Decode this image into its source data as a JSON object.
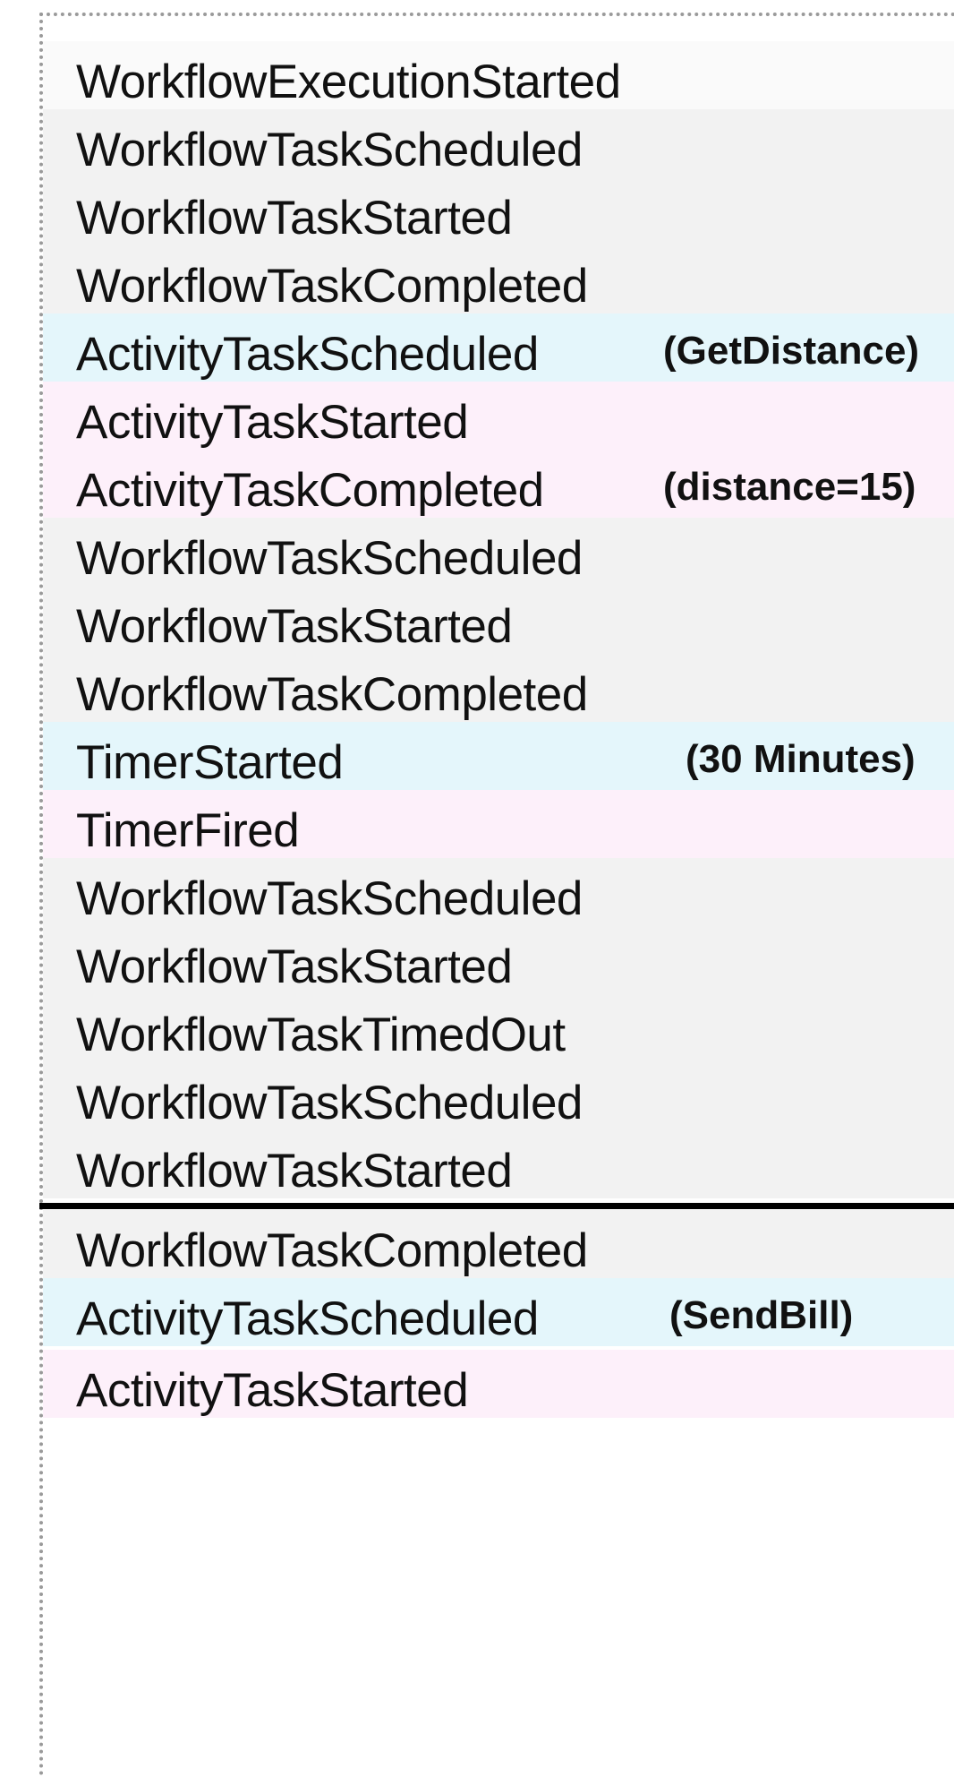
{
  "colors": {
    "workflow": "#f2f2f2",
    "activity_scheduled": "#e4f6fb",
    "activity_result": "#fdf0fa",
    "first_row": "#fafafa",
    "divider": "#000000"
  },
  "history_before": [
    {
      "event": "WorkflowExecutionStarted",
      "note": "",
      "kind": "first_row"
    },
    {
      "event": "WorkflowTaskScheduled",
      "note": "",
      "kind": "workflow"
    },
    {
      "event": "WorkflowTaskStarted",
      "note": "",
      "kind": "workflow"
    },
    {
      "event": "WorkflowTaskCompleted",
      "note": "",
      "kind": "workflow"
    },
    {
      "event": "ActivityTaskScheduled",
      "note": "(GetDistance)",
      "kind": "activity_scheduled"
    },
    {
      "event": "ActivityTaskStarted",
      "note": "",
      "kind": "activity_result"
    },
    {
      "event": "ActivityTaskCompleted",
      "note": "(distance=15)",
      "kind": "activity_result"
    },
    {
      "event": "WorkflowTaskScheduled",
      "note": "",
      "kind": "workflow"
    },
    {
      "event": "WorkflowTaskStarted",
      "note": "",
      "kind": "workflow"
    },
    {
      "event": "WorkflowTaskCompleted",
      "note": "",
      "kind": "workflow"
    },
    {
      "event": "TimerStarted",
      "note": "(30 Minutes)",
      "kind": "activity_scheduled"
    },
    {
      "event": "TimerFired",
      "note": "",
      "kind": "activity_result"
    },
    {
      "event": "WorkflowTaskScheduled",
      "note": "",
      "kind": "workflow"
    },
    {
      "event": "WorkflowTaskStarted",
      "note": "",
      "kind": "workflow"
    },
    {
      "event": "WorkflowTaskTimedOut",
      "note": "",
      "kind": "workflow"
    },
    {
      "event": "WorkflowTaskScheduled",
      "note": "",
      "kind": "workflow"
    },
    {
      "event": "WorkflowTaskStarted",
      "note": "",
      "kind": "workflow"
    }
  ],
  "history_after": [
    {
      "event": "WorkflowTaskCompleted",
      "note": "",
      "kind": "workflow"
    },
    {
      "event": "ActivityTaskScheduled",
      "note": "(SendBill)",
      "kind": "activity_scheduled"
    },
    {
      "event": "ActivityTaskStarted",
      "note": "",
      "kind": "activity_result"
    }
  ]
}
